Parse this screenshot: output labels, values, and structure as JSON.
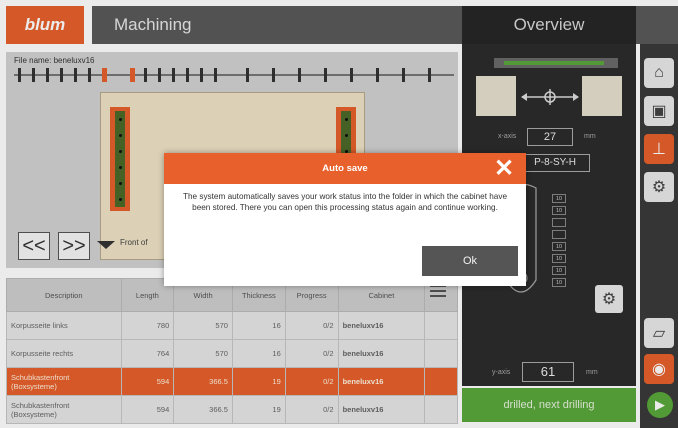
{
  "header": {
    "logo": "blum",
    "title": "Machining",
    "overview": "Overview"
  },
  "workarea": {
    "file_name": "File name: beneluxv16",
    "front_label": "Front of"
  },
  "nav": {
    "prev": "<<",
    "next": ">>"
  },
  "table": {
    "headers": [
      "Description",
      "Length",
      "Width",
      "Thickness",
      "Progress",
      "Cabinet"
    ],
    "rows": [
      {
        "description": "Korpusseite links",
        "length": "780",
        "width": "570",
        "thickness": "16",
        "progress": "0/2",
        "cabinet": "beneluxv16",
        "selected": false
      },
      {
        "description": "Korpusseite rechts",
        "length": "764",
        "width": "570",
        "thickness": "16",
        "progress": "0/2",
        "cabinet": "beneluxv16",
        "selected": false
      },
      {
        "description": "Schubkastenfront (Boxsysteme)",
        "length": "594",
        "width": "366.5",
        "thickness": "19",
        "progress": "0/2",
        "cabinet": "beneluxv16",
        "selected": true
      },
      {
        "description": "Schubkastenfront (Boxsysteme)",
        "length": "594",
        "width": "366.5",
        "thickness": "19",
        "progress": "0/2",
        "cabinet": "beneluxv16",
        "selected": false
      }
    ]
  },
  "right_panel": {
    "x_axis_label": "x-axis",
    "x_axis_value": "27",
    "x_unit": "mm",
    "program": "P-8-SY-H",
    "slots": [
      "10",
      "10",
      "",
      "",
      "10",
      "10",
      "10",
      "10"
    ],
    "y_axis_label": "y-axis",
    "y_axis_value": "61",
    "y_unit": "mm",
    "status": "drilled, next drilling"
  },
  "dialog": {
    "title": "Auto save",
    "message": "The system automatically saves your work status into the folder in which the cabinet have been stored. There you can open this processing status again and continue working.",
    "ok": "Ok"
  },
  "colors": {
    "accent": "#e8612c",
    "dark": "#2c2c2c",
    "green": "#5aa83a"
  }
}
